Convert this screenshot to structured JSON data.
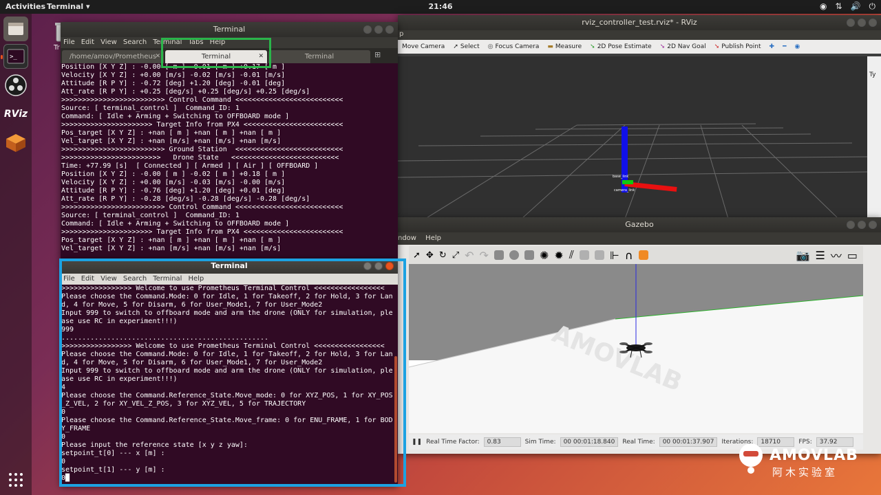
{
  "topbar": {
    "activities": "Activities",
    "app_menu": "Terminal ▾",
    "clock": "21:46",
    "tray_icons": [
      "help-circle-icon",
      "network-icon",
      "volume-icon",
      "power-icon"
    ]
  },
  "dock": {
    "items": [
      "files-icon",
      "terminal-icon",
      "obs-icon",
      "rviz-icon",
      "software-icon",
      "apps-grid-icon"
    ],
    "rviz_label": "RViz"
  },
  "desktop": {
    "trash_label": "Tr"
  },
  "rviz": {
    "title": "rviz_controller_test.rviz* - RViz",
    "menu_fragment": "p",
    "tools": [
      "Move Camera",
      "Select",
      "Focus Camera",
      "Measure",
      "2D Pose Estimate",
      "2D Nav Goal",
      "Publish Point"
    ],
    "side_label": "Ty",
    "labels": [
      "base_link",
      "camera_link"
    ]
  },
  "gazebo": {
    "title": "Gazebo",
    "menu": [
      "ndow",
      "Help"
    ],
    "status": {
      "rtf_label": "Real Time Factor:",
      "rtf": "0.83",
      "sim_label": "Sim Time:",
      "sim": "00 00:01:18.840",
      "real_label": "Real Time:",
      "real": "00 00:01:37.907",
      "iter_label": "Iterations:",
      "iter": "18710",
      "fps_label": "FPS:",
      "fps": "37.92"
    },
    "ground_watermark": "AMOVLAB"
  },
  "term1": {
    "title": "Terminal",
    "menu": [
      "File",
      "Edit",
      "View",
      "Search",
      "Terminal",
      "Tabs",
      "Help"
    ],
    "tabs": [
      "/home/amov/Prometheus",
      "Terminal",
      "Terminal"
    ],
    "lines": [
      "Position [X Y Z] : -0.00 [ m ] -0.01 [ m ] +0.17 [ m ]",
      "Velocity [X Y Z] : +0.00 [m/s] -0.02 [m/s] -0.01 [m/s]",
      "Attitude [R P Y] : -0.72 [deg] +1.20 [deg] -0.01 [deg]",
      "Att_rate [R P Y] : +0.25 [deg/s] +0.25 [deg/s] +0.25 [deg/s]",
      ">>>>>>>>>>>>>>>>>>>>>>>>> Control Command <<<<<<<<<<<<<<<<<<<<<<<<<<",
      "Source: [ terminal_control ]  Command_ID: 1",
      "Command: [ Idle + Arming + Switching to OFFBOARD mode ]",
      ">>>>>>>>>>>>>>>>>>>>>> Target Info from PX4 <<<<<<<<<<<<<<<<<<<<<<<<",
      "Pos_target [X Y Z] : +nan [ m ] +nan [ m ] +nan [ m ]",
      "Vel_target [X Y Z] : +nan [m/s] +nan [m/s] +nan [m/s]",
      ">>>>>>>>>>>>>>>>>>>>>>>>> Ground Station  <<<<<<<<<<<<<<<<<<<<<<<<<<",
      ">>>>>>>>>>>>>>>>>>>>>>>>   Drone State   <<<<<<<<<<<<<<<<<<<<<<<<<<",
      "Time: +77.99 [s]  [ Connected ] [ Armed ] [ Air ] [ OFFBOARD ]",
      "Position [X Y Z] : -0.00 [ m ] -0.02 [ m ] +0.18 [ m ]",
      "Velocity [X Y Z] : +0.00 [m/s] -0.03 [m/s] -0.00 [m/s]",
      "Attitude [R P Y] : -0.76 [deg] +1.20 [deg] +0.01 [deg]",
      "Att_rate [R P Y] : -0.28 [deg/s] -0.28 [deg/s] -0.28 [deg/s]",
      ">>>>>>>>>>>>>>>>>>>>>>>>> Control Command <<<<<<<<<<<<<<<<<<<<<<<<<<",
      "Source: [ terminal_control ]  Command_ID: 1",
      "Command: [ Idle + Arming + Switching to OFFBOARD mode ]",
      ">>>>>>>>>>>>>>>>>>>>>> Target Info from PX4 <<<<<<<<<<<<<<<<<<<<<<<<",
      "Pos_target [X Y Z] : +nan [ m ] +nan [ m ] +nan [ m ]",
      "Vel_target [X Y Z] : +nan [m/s] +nan [m/s] +nan [m/s]"
    ]
  },
  "term2": {
    "title": "Terminal",
    "menu": [
      "File",
      "Edit",
      "View",
      "Search",
      "Terminal",
      "Help"
    ],
    "lines": [
      ">>>>>>>>>>>>>>>>> Welcome to use Prometheus Terminal Control <<<<<<<<<<<<<<<<<",
      "Please choose the Command.Mode: 0 for Idle, 1 for Takeoff, 2 for Hold, 3 for Lan",
      "d, 4 for Move, 5 for Disarm, 6 for User_Mode1, 7 for User_Mode2",
      "Input 999 to switch to offboard mode and arm the drone (ONLY for simulation, ple",
      "ase use RC in experiment!!!)",
      "999",
      "..................................................",
      ">>>>>>>>>>>>>>>>> Welcome to use Prometheus Terminal Control <<<<<<<<<<<<<<<<<",
      "Please choose the Command.Mode: 0 for Idle, 1 for Takeoff, 2 for Hold, 3 for Lan",
      "d, 4 for Move, 5 for Disarm, 6 for User_Mode1, 7 for User_Mode2",
      "Input 999 to switch to offboard mode and arm the drone (ONLY for simulation, ple",
      "ase use RC in experiment!!!)",
      "4",
      "Please choose the Command.Reference_State.Move_mode: 0 for XYZ_POS, 1 for XY_POS",
      "_Z_VEL, 2 for XY_VEL_Z_POS, 3 for XYZ_VEL, 5 for TRAJECTORY",
      "0",
      "Please choose the Command.Reference_State.Move_frame: 0 for ENU_FRAME, 1 for BOD",
      "Y_FRAME",
      "0",
      "Please input the reference state [x y z yaw]:",
      "setpoint_t[0] --- x [m] :",
      "0",
      "setpoint_t[1] --- y [m] :",
      "0"
    ]
  },
  "watermark": {
    "brand": "AMOVLAB",
    "sub": "阿木实验室"
  },
  "colors": {
    "highlight_green": "#2ab54a",
    "highlight_blue": "#1ca2e2",
    "terminal_bg": "#300a24",
    "ubuntu_orange": "#e95420"
  }
}
